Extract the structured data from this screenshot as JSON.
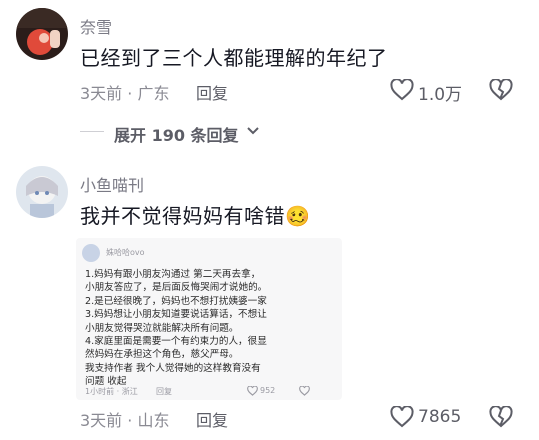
{
  "comments": [
    {
      "username": "奈雪",
      "text": "已经到了三个人都能理解的年纪了",
      "meta": "3天前 · 广东",
      "reply_label": "回复",
      "likes": "1.0万"
    },
    {
      "username": "小鱼喵刊",
      "text": "我并不觉得妈妈有啥错",
      "emoji": "🥴",
      "meta": "3天前 · 山东",
      "reply_label": "回复",
      "likes": "7865"
    }
  ],
  "expand_label": "展开 190 条回复",
  "embedded_screenshot": {
    "username": "姝哈哈ovo",
    "lines": [
      "1.妈妈有跟小朋友沟通过 第二天再去拿，",
      "小朋友答应了，是后面反悔哭闹才说她的。",
      "2.是已经很晚了，妈妈也不想打扰姨婆一家",
      "3.妈妈想让小朋友知道要说话算话，不想让",
      "小朋友觉得哭泣就能解决所有问题。",
      "4.家庭里面是需要一个有约束力的人，很显",
      "然妈妈在承担这个角色，慈父严母。",
      "我支持作者 我个人觉得她的这样教育没有",
      "问题 收起"
    ],
    "meta": "1小时前 · 浙江",
    "reply_label": "回复",
    "likes": "952"
  },
  "colors": {
    "text": "#161823",
    "secondary": "#8a8a93",
    "background": "#ffffff"
  }
}
